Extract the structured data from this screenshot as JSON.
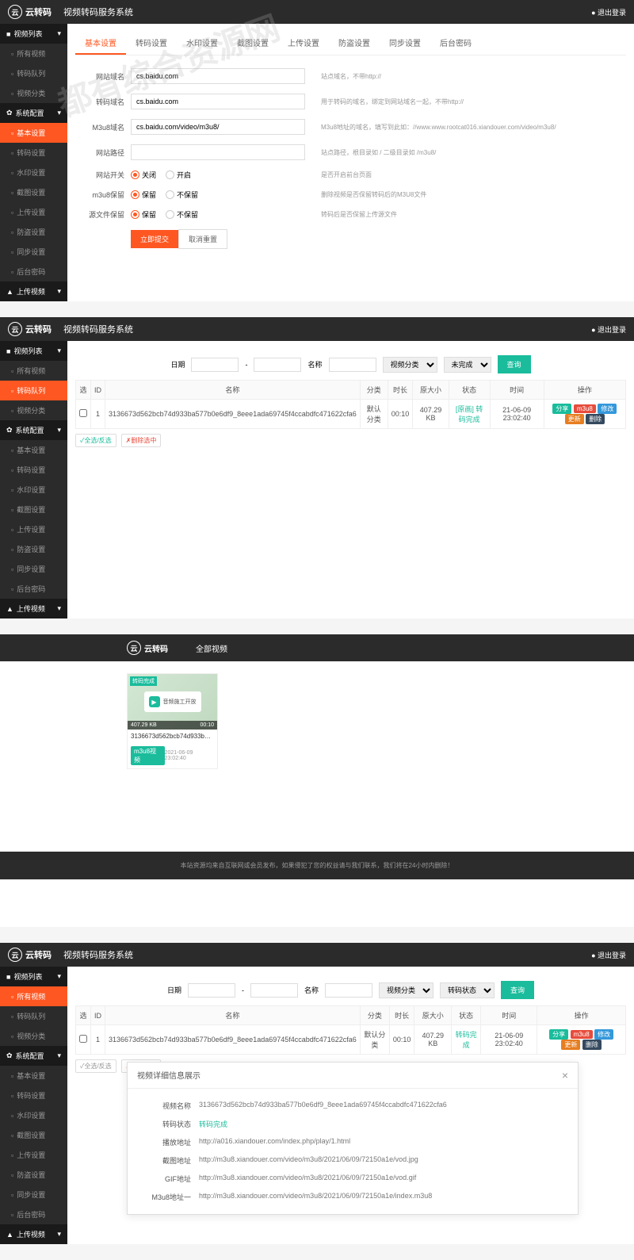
{
  "header": {
    "brand": "云转码",
    "title": "视频转码服务系统",
    "logout": "● 退出登录"
  },
  "sidebar1": {
    "groups": [
      {
        "label": "视频列表",
        "type": "header"
      },
      {
        "label": "所有视频",
        "type": "sub"
      },
      {
        "label": "转码队列",
        "type": "sub"
      },
      {
        "label": "视频分类",
        "type": "sub"
      },
      {
        "label": "系统配置",
        "type": "header"
      },
      {
        "label": "基本设置",
        "type": "sub",
        "active": true
      },
      {
        "label": "转码设置",
        "type": "sub"
      },
      {
        "label": "水印设置",
        "type": "sub"
      },
      {
        "label": "截图设置",
        "type": "sub"
      },
      {
        "label": "上传设置",
        "type": "sub"
      },
      {
        "label": "防盗设置",
        "type": "sub"
      },
      {
        "label": "同步设置",
        "type": "sub"
      },
      {
        "label": "后台密码",
        "type": "sub"
      },
      {
        "label": "上传视频",
        "type": "header"
      }
    ]
  },
  "tabs1": [
    "基本设置",
    "转码设置",
    "水印设置",
    "截图设置",
    "上传设置",
    "防盗设置",
    "同步设置",
    "后台密码"
  ],
  "form1": {
    "rows": [
      {
        "label": "网站域名",
        "value": "cs.baidu.com",
        "desc": "站点域名，不带http://"
      },
      {
        "label": "转码域名",
        "value": "cs.baidu.com",
        "desc": "用于转码的域名，绑定到网站域名一起，不带http://"
      },
      {
        "label": "M3u8域名",
        "value": "cs.baidu.com/video/m3u8/",
        "desc": "M3u8地址的域名，填写到此如：//www.www.rootcat016.xiandouer.com/video/m3u8/"
      },
      {
        "label": "网站路径",
        "value": "",
        "desc": "站点路径，根目录如 / 二级目录如 /m3u8/"
      }
    ],
    "radios": [
      {
        "label": "网站开关",
        "opt1": "关闭",
        "opt2": "开启",
        "checked": 0,
        "desc": "是否开启前台页面"
      },
      {
        "label": "m3u8保留",
        "opt1": "保留",
        "opt2": "不保留",
        "checked": 0,
        "desc": "删除视频是否保留转码后的M3U8文件"
      },
      {
        "label": "源文件保留",
        "opt1": "保留",
        "opt2": "不保留",
        "checked": 0,
        "desc": "转码后是否保留上传源文件"
      }
    ],
    "submit": "立即提交",
    "reset": "取消重置"
  },
  "sidebar2_active": "转码队列",
  "filter": {
    "date": "日期",
    "name": "名称",
    "category": "视频分类",
    "status": "未完成",
    "search": "查询"
  },
  "table": {
    "headers": [
      "选",
      "ID",
      "名称",
      "分类",
      "时长",
      "原大小",
      "状态",
      "时间",
      "操作"
    ],
    "row": {
      "id": "1",
      "name": "3136673d562bcb74d933ba577b0e6df9_8eee1ada69745f4ccabdfc471622cfa6",
      "cat": "默认分类",
      "dur": "00:10",
      "size": "407.29 KB",
      "status": "[原画] 转码完成",
      "time": "21-06-09 23:02:40"
    },
    "actions": [
      "分享",
      "m3u8",
      "修改",
      "更新",
      "删除"
    ]
  },
  "bulk": {
    "select": "✓全选/反选",
    "delete": "✗删除选中"
  },
  "videoPage": {
    "nav": "全部视频",
    "card": {
      "badge": "转码完成",
      "size": "407.29 KB",
      "dur": "00:10",
      "title": "3136673d562bcb74d933ba5...",
      "tag": "m3u8视频",
      "date": "2021-06-09 23:02:40",
      "thumbText": "音频施工开放"
    },
    "footer": "本站资源均来自互联网或会员发布，如果侵犯了您的权益请与我们联系，我们将在24小时内删除！"
  },
  "sidebar4_active": "所有视频",
  "filter4_status": "转码状态",
  "table4_status": "转码完成",
  "modal": {
    "title": "视频详细信息展示",
    "rows": [
      {
        "label": "视频名称",
        "value": "3136673d562bcb74d933ba577b0e6df9_8eee1ada69745f4ccabdfc471622cfa6"
      },
      {
        "label": "转码状态",
        "value": "转码完成",
        "status": true
      },
      {
        "label": "播放地址",
        "value": "http://a016.xiandouer.com/index.php/play/1.html"
      },
      {
        "label": "截图地址",
        "value": "http://m3u8.xiandouer.com/video/m3u8/2021/06/09/72150a1e/vod.jpg"
      },
      {
        "label": "GIF地址",
        "value": "http://m3u8.xiandouer.com/video/m3u8/2021/06/09/72150a1e/vod.gif"
      },
      {
        "label": "M3u8地址一",
        "value": "http://m3u8.xiandouer.com/video/m3u8/2021/06/09/72150a1e/index.m3u8"
      }
    ]
  },
  "watermark": "都有综合资源网"
}
